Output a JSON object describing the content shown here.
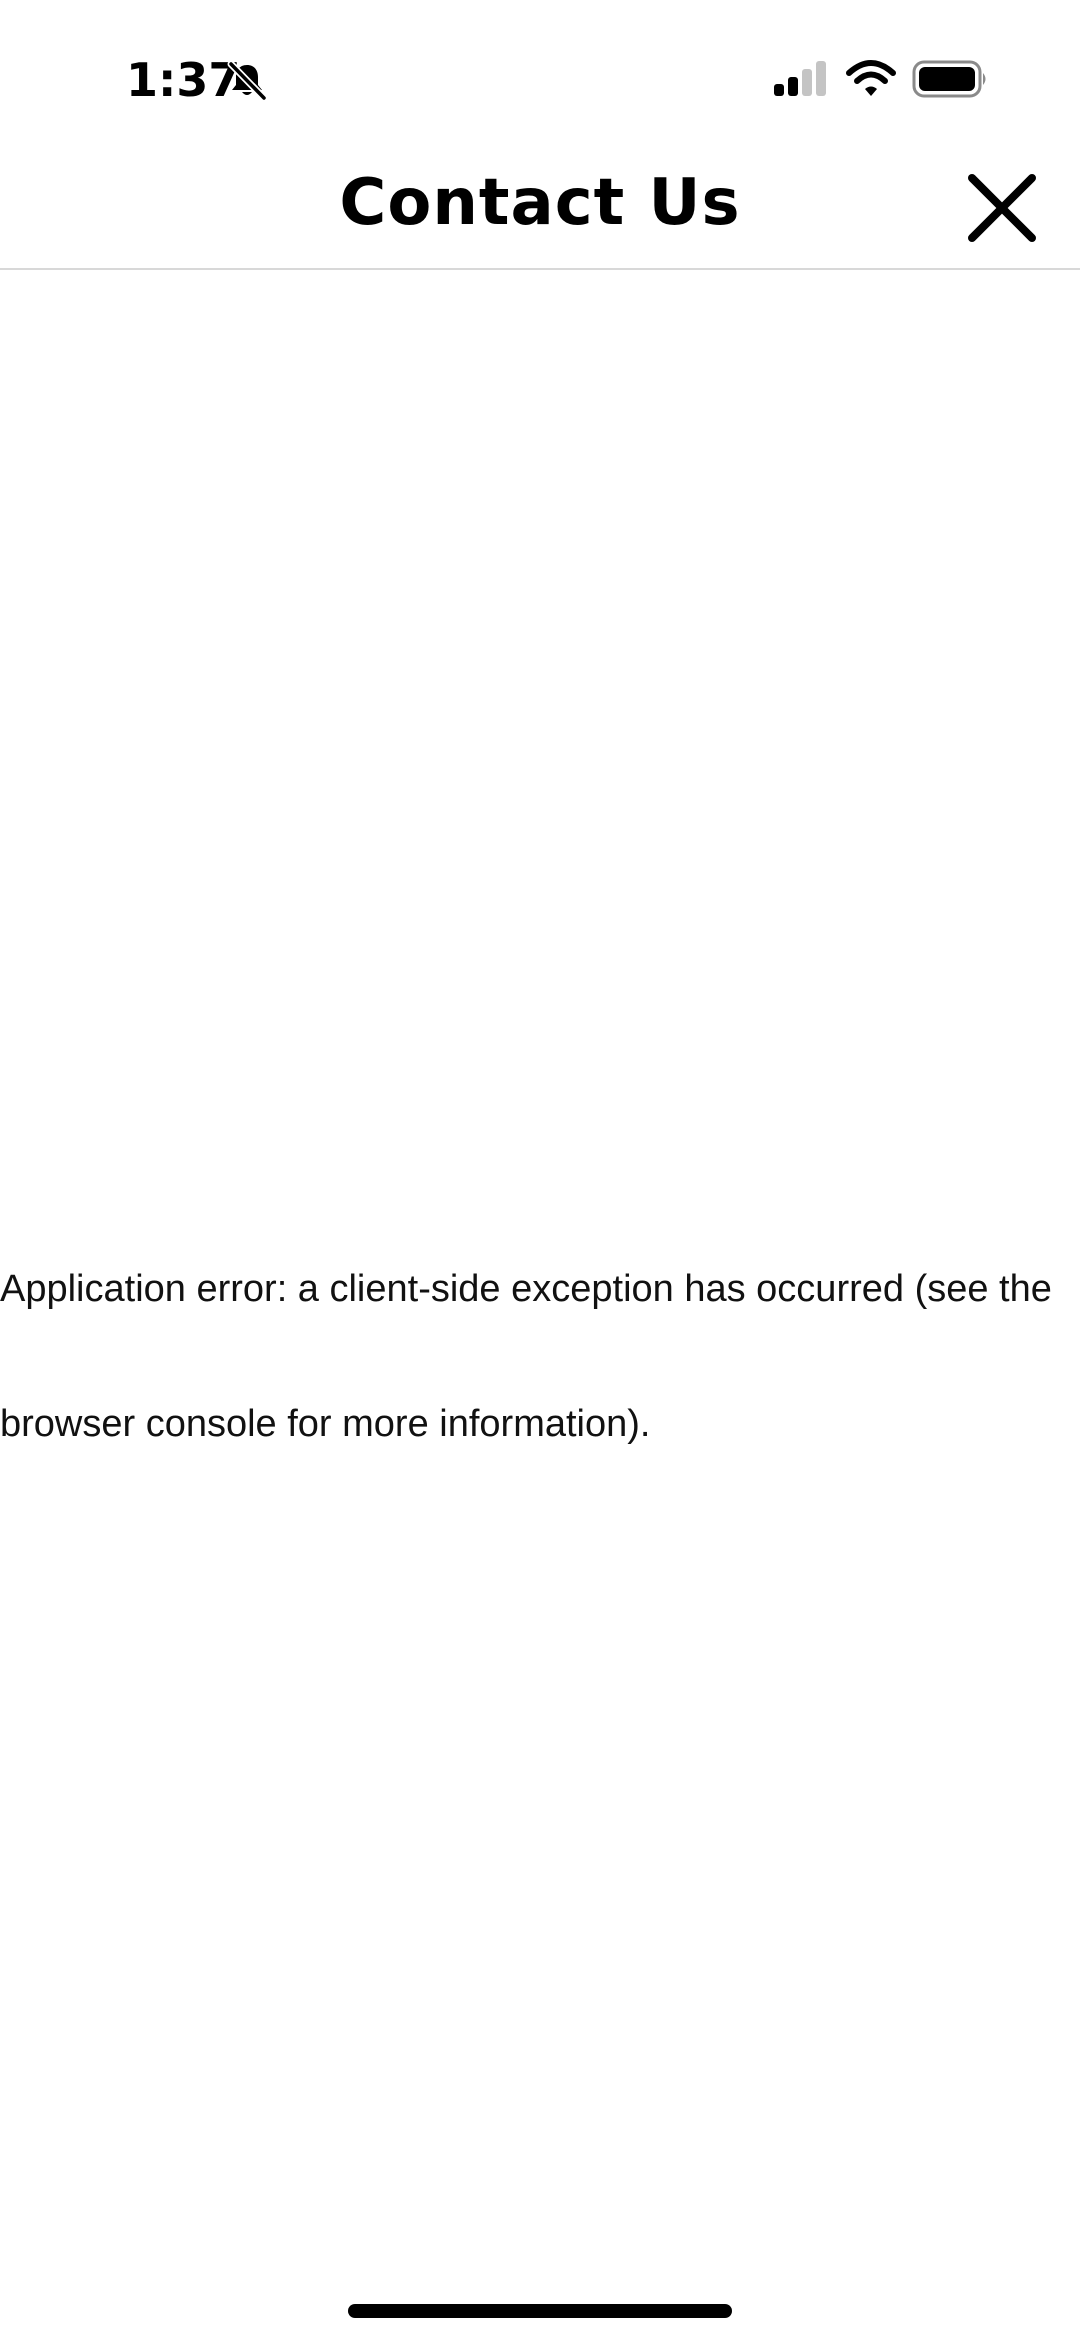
{
  "status_bar": {
    "time": "1:37",
    "silent_icon": "bell-slash-icon",
    "signal_icon": "cellular-signal-icon",
    "wifi_icon": "wifi-icon",
    "battery_icon": "battery-icon"
  },
  "header": {
    "title": "Contact Us",
    "close_icon": "close-icon"
  },
  "main": {
    "error_message": "Application error: a client-side exception has occurred (see the browser console for more information)."
  },
  "colors": {
    "background": "#ffffff",
    "text": "#000000",
    "divider": "#d8d8d8"
  }
}
